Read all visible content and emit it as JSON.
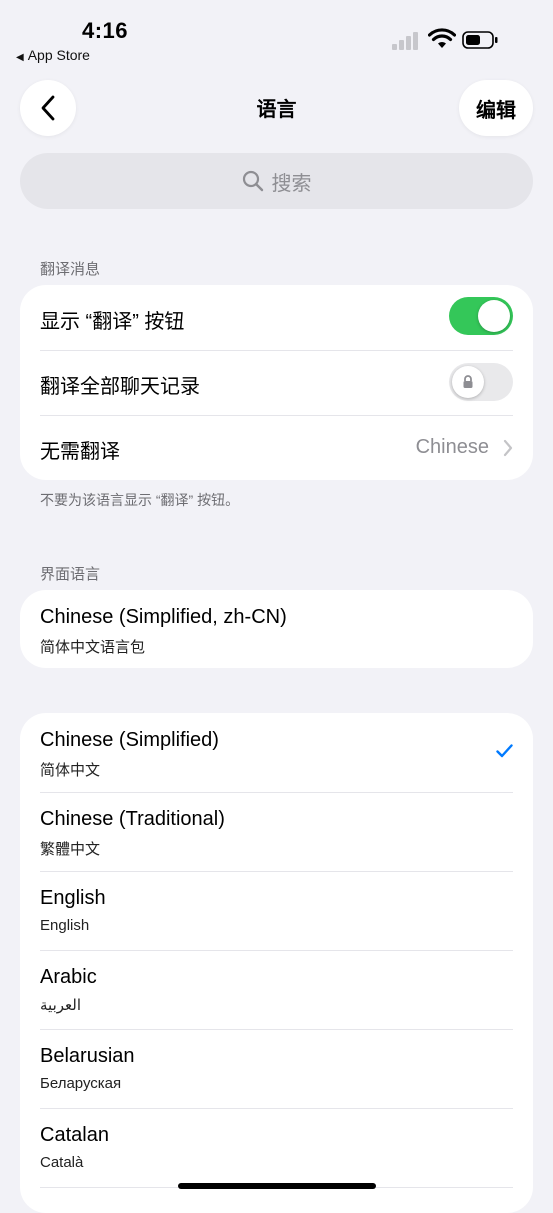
{
  "status_bar": {
    "time": "4:16",
    "back_app": "App Store"
  },
  "nav": {
    "title": "语言",
    "edit_label": "编辑"
  },
  "search": {
    "placeholder": "搜索"
  },
  "translate_section": {
    "header": "翻译消息",
    "show_button_label": "显示 “翻译” 按钮",
    "show_button_on": true,
    "translate_all_label": "翻译全部聊天记录",
    "translate_all_on": false,
    "no_translate_label": "无需翻译",
    "no_translate_value": "Chinese",
    "footnote": "不要为该语言显示 “翻译” 按钮。"
  },
  "interface_section": {
    "header": "界面语言",
    "name": "Chinese (Simplified, zh-CN)",
    "native": "简体中文语言包"
  },
  "languages": [
    {
      "name": "Chinese (Simplified)",
      "native": "简体中文",
      "selected": true
    },
    {
      "name": "Chinese (Traditional)",
      "native": "繁體中文",
      "selected": false
    },
    {
      "name": "English",
      "native": "English",
      "selected": false
    },
    {
      "name": "Arabic",
      "native": "العربية",
      "selected": false
    },
    {
      "name": "Belarusian",
      "native": "Беларуская",
      "selected": false
    },
    {
      "name": "Catalan",
      "native": "Català",
      "selected": false
    }
  ],
  "colors": {
    "toggle_on": "#34c759",
    "checkmark": "#007aff",
    "background": "#f2f2f7"
  }
}
